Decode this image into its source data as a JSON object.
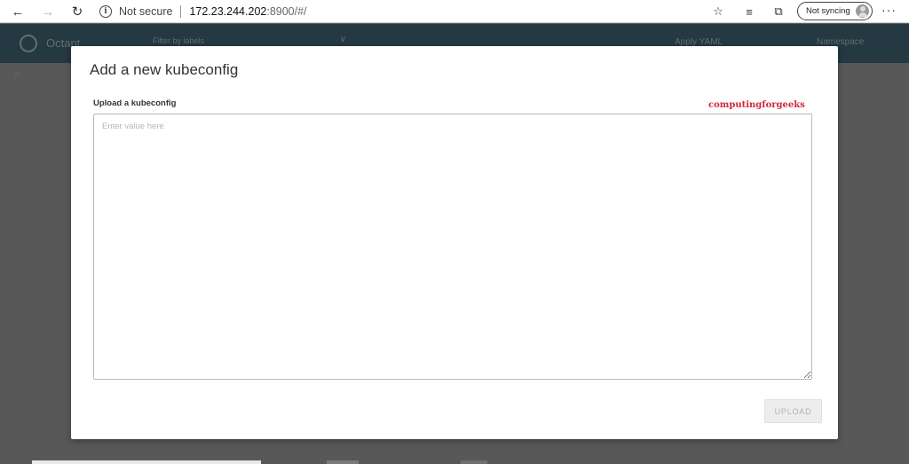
{
  "browser": {
    "security_label": "Not secure",
    "url_host": "172.23.244.202",
    "url_path": ":8900/#/",
    "sync_label": "Not syncing"
  },
  "background_app": {
    "name": "Octant",
    "filter_placeholder": "Filter by labels",
    "user_label": "Apply YAML",
    "namespace_label": "Namespace"
  },
  "modal": {
    "title": "Add a new kubeconfig",
    "field_label": "Upload a kubeconfig",
    "watermark": "computingforgeeks",
    "textarea_placeholder": "Enter value here",
    "textarea_value": "",
    "upload_button": "UPLOAD"
  }
}
